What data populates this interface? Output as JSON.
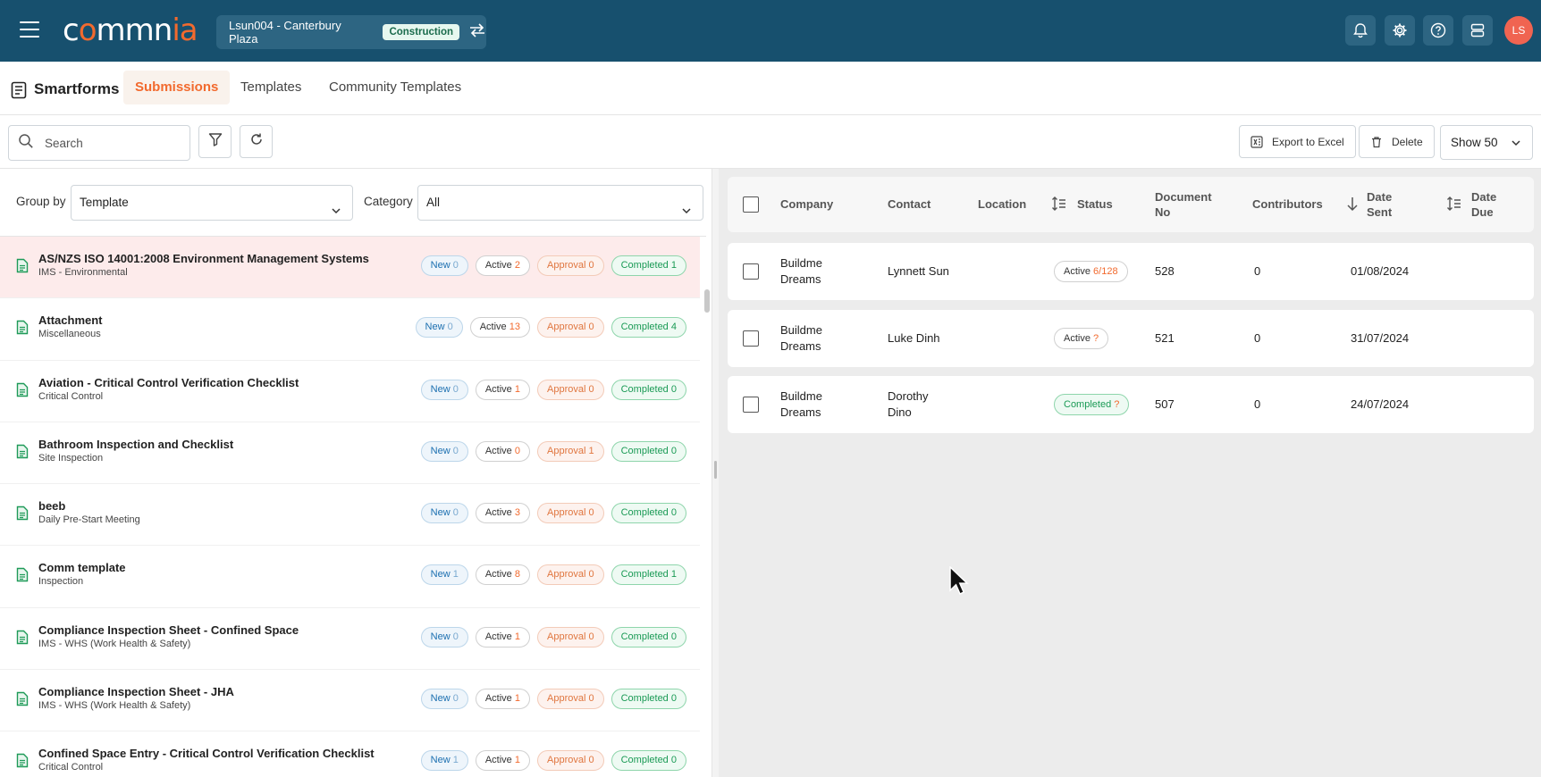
{
  "app": {
    "logo_text": "commnia"
  },
  "project": {
    "name": "Lsun004 - Canterbury Plaza",
    "tag": "Construction"
  },
  "user": {
    "initials": "LS"
  },
  "header_icons": [
    "bell-icon",
    "gear-icon",
    "help-icon",
    "server-icon"
  ],
  "section": {
    "title": "Smartforms"
  },
  "tabs": [
    {
      "label": "Submissions",
      "active": true
    },
    {
      "label": "Templates",
      "active": false
    },
    {
      "label": "Community Templates",
      "active": false
    }
  ],
  "toolbar": {
    "search_placeholder": "Search",
    "export_label": "Export to Excel",
    "delete_label": "Delete",
    "show_label": "Show 50"
  },
  "filters": {
    "group_by_label": "Group by",
    "group_by_value": "Template",
    "category_label": "Category",
    "category_value": "All"
  },
  "templates": [
    {
      "name": "AS/NZS ISO 14001:2008 Environment Management Systems",
      "category": "IMS - Environmental",
      "new": "0",
      "active": "2",
      "approval": "0",
      "completed": "1",
      "selected": true
    },
    {
      "name": "Attachment",
      "category": "Miscellaneous",
      "new": "0",
      "active": "13",
      "approval": "0",
      "completed": "4"
    },
    {
      "name": "Aviation - Critical Control Verification Checklist",
      "category": "Critical Control",
      "new": "0",
      "active": "1",
      "approval": "0",
      "completed": "0"
    },
    {
      "name": "Bathroom Inspection and Checklist",
      "category": "Site Inspection",
      "new": "0",
      "active": "0",
      "approval": "1",
      "completed": "0"
    },
    {
      "name": "beeb",
      "category": "Daily Pre-Start Meeting",
      "new": "0",
      "active": "3",
      "approval": "0",
      "completed": "0"
    },
    {
      "name": "Comm template",
      "category": "Inspection",
      "new": "1",
      "active": "8",
      "approval": "0",
      "completed": "1"
    },
    {
      "name": "Compliance Inspection Sheet - Confined Space",
      "category": "IMS - WHS (Work Health & Safety)",
      "new": "0",
      "active": "1",
      "approval": "0",
      "completed": "0"
    },
    {
      "name": "Compliance Inspection Sheet - JHA",
      "category": "IMS - WHS (Work Health & Safety)",
      "new": "0",
      "active": "1",
      "approval": "0",
      "completed": "0"
    },
    {
      "name": "Confined Space Entry - Critical Control Verification Checklist",
      "category": "Critical Control",
      "new": "1",
      "active": "1",
      "approval": "0",
      "completed": "0"
    }
  ],
  "pill_labels": {
    "new": "New",
    "active": "Active",
    "approval": "Approval",
    "completed": "Completed"
  },
  "table": {
    "headers": {
      "company": "Company",
      "contact": "Contact",
      "location": "Location",
      "status": "Status",
      "document_no_1": "Document",
      "document_no_2": "No",
      "contributors": "Contributors",
      "date_sent_1": "Date",
      "date_sent_2": "Sent",
      "date_due_1": "Date",
      "date_due_2": "Due"
    },
    "rows": [
      {
        "company_1": "Buildme",
        "company_2": "Dreams",
        "contact_1": "Lynnett Sun",
        "contact_2": "",
        "location": "",
        "status": "Active",
        "status_count": "6/128",
        "status_type": "active",
        "document_no": "528",
        "contributors": "0",
        "date_sent": "01/08/2024",
        "date_due": ""
      },
      {
        "company_1": "Buildme",
        "company_2": "Dreams",
        "contact_1": "Luke Dinh",
        "contact_2": "",
        "location": "",
        "status": "Active",
        "status_count": "?",
        "status_type": "active",
        "document_no": "521",
        "contributors": "0",
        "date_sent": "31/07/2024",
        "date_due": ""
      },
      {
        "company_1": "Buildme",
        "company_2": "Dreams",
        "contact_1": "Dorothy",
        "contact_2": "Dino",
        "location": "",
        "status": "Completed",
        "status_count": "?",
        "status_type": "completed",
        "document_no": "507",
        "contributors": "0",
        "date_sent": "24/07/2024",
        "date_due": ""
      }
    ]
  }
}
